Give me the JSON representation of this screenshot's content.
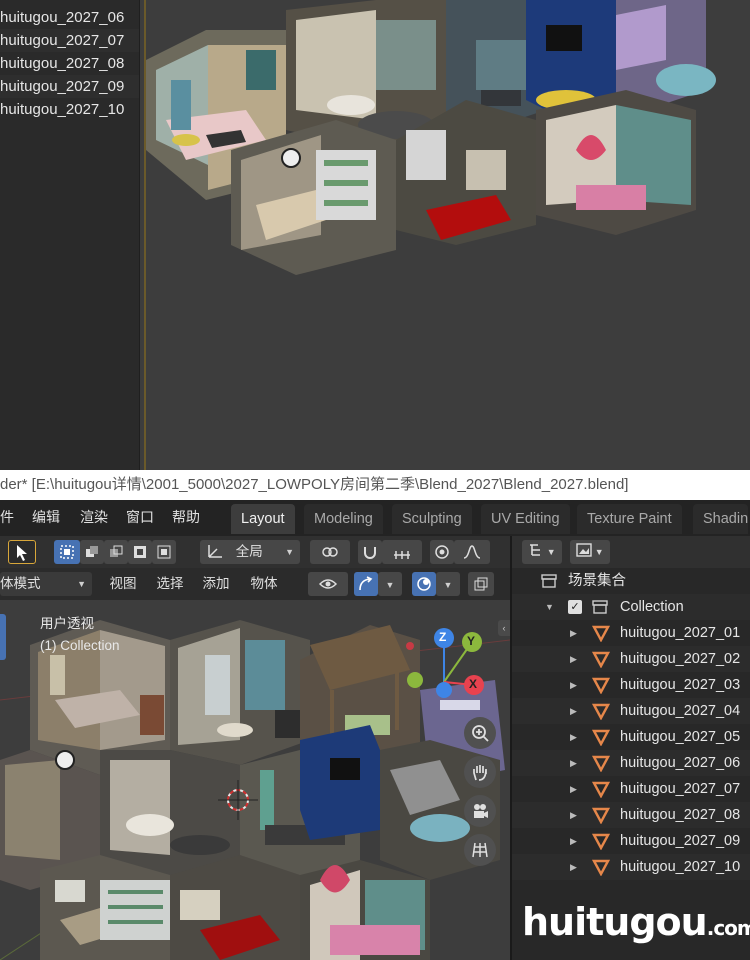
{
  "top_outliner": {
    "items": [
      "huitugou_2027_06",
      "huitugou_2027_07",
      "huitugou_2027_08",
      "huitugou_2027_09",
      "huitugou_2027_10"
    ]
  },
  "title_bar": {
    "text": "der* [E:\\huitugou详情\\2001_5000\\2027_LOWPOLY房间第二季\\Blend_2027\\Blend_2027.blend]"
  },
  "menu": {
    "items": [
      "件",
      "编辑",
      "渲染",
      "窗口",
      "帮助"
    ]
  },
  "workspace_tabs": [
    {
      "label": "Layout",
      "active": true
    },
    {
      "label": "Modeling",
      "active": false
    },
    {
      "label": "Sculpting",
      "active": false
    },
    {
      "label": "UV Editing",
      "active": false
    },
    {
      "label": "Texture Paint",
      "active": false
    },
    {
      "label": "Shadin",
      "active": false
    }
  ],
  "header1": {
    "transform_orientation": "全局"
  },
  "header2": {
    "mode": "体模式",
    "menus": [
      "视图",
      "选择",
      "添加",
      "物体"
    ]
  },
  "viewport": {
    "view_label": "用户透视",
    "collection_label": "(1) Collection",
    "axes": {
      "z": "Z",
      "y": "Y",
      "x": "X"
    }
  },
  "outliner": {
    "scene_collection": "场景集合",
    "collection": "Collection",
    "objects": [
      "huitugou_2027_01",
      "huitugou_2027_02",
      "huitugou_2027_03",
      "huitugou_2027_04",
      "huitugou_2027_05",
      "huitugou_2027_06",
      "huitugou_2027_07",
      "huitugou_2027_08",
      "huitugou_2027_09",
      "huitugou_2027_10"
    ]
  },
  "watermark": {
    "main": "huitugou",
    "suffix": ".com"
  },
  "colors": {
    "accent_blue": "#4772b3",
    "mesh_orange": "#e6874a",
    "axis_x": "#e8424f",
    "axis_y": "#8cb83d",
    "axis_z": "#3e85e6"
  }
}
